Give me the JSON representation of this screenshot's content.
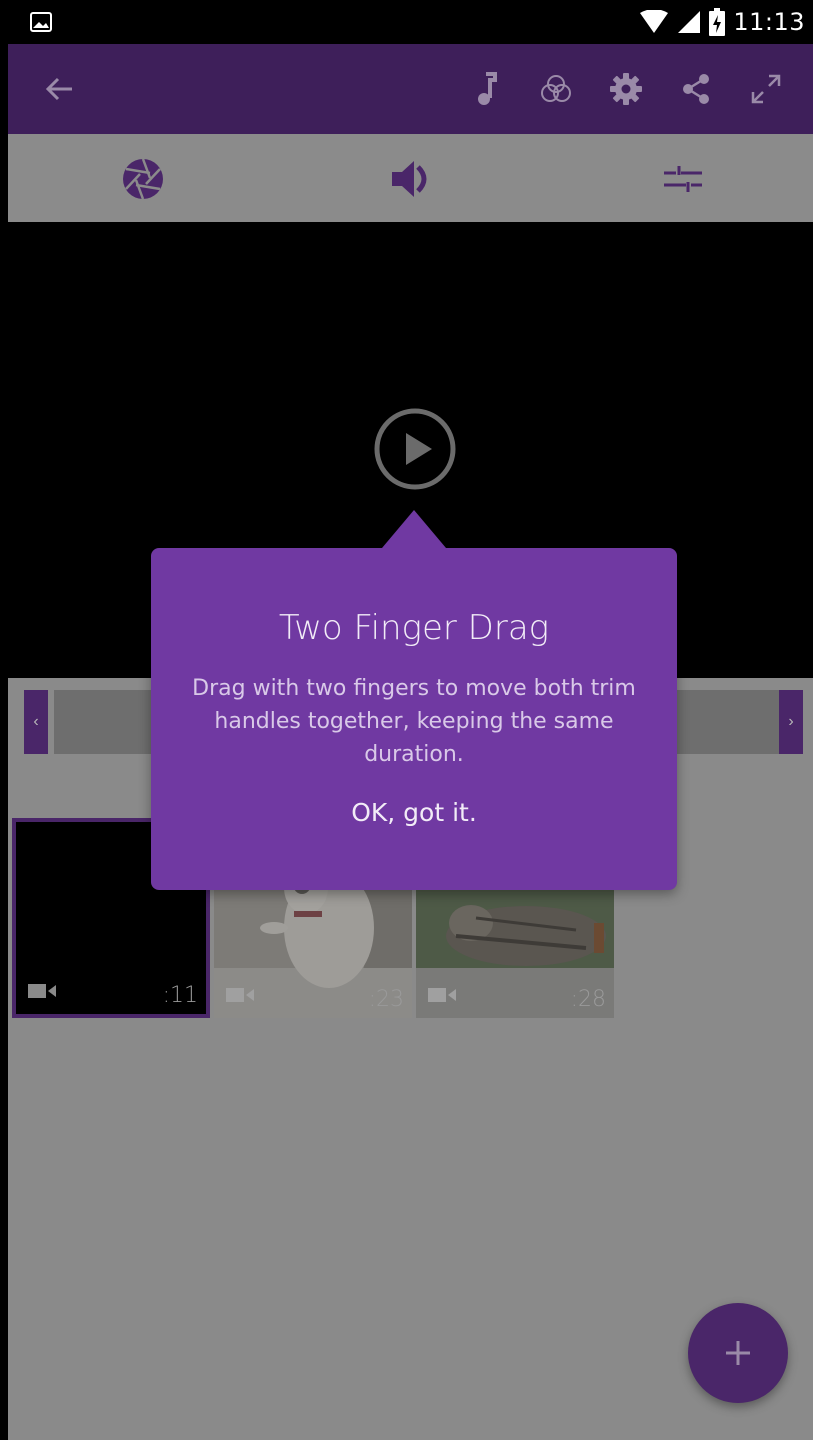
{
  "status_bar": {
    "time": "11:13",
    "icons": [
      "gallery-notification-icon",
      "wifi-icon",
      "cell-signal-icon",
      "battery-charging-icon"
    ]
  },
  "app_bar": {
    "back_icon": "arrow-left-icon",
    "actions": [
      "music-note-icon",
      "color-filter-icon",
      "gear-icon",
      "share-icon",
      "expand-icon"
    ]
  },
  "tool_bar": {
    "items": [
      "aperture-icon",
      "volume-icon",
      "sliders-icon"
    ]
  },
  "video": {
    "play_icon": "play-circle-icon"
  },
  "trim": {
    "left_handle": "‹",
    "right_handle": "›"
  },
  "clips": [
    {
      "duration": ":11",
      "selected": true
    },
    {
      "duration": ":23",
      "selected": false
    },
    {
      "duration": ":28",
      "selected": false
    }
  ],
  "tooltip": {
    "title": "Two Finger Drag",
    "body": "Drag with two fingers to move both trim handles together, keeping the same duration.",
    "ok_label": "OK, got it."
  },
  "fab": {
    "icon": "plus-icon"
  },
  "colors": {
    "app_bar": "#3e1f5a",
    "tooltip": "#7039a2",
    "accent_dark": "#4a2669",
    "scrim_gray": "#8a8a8a"
  }
}
